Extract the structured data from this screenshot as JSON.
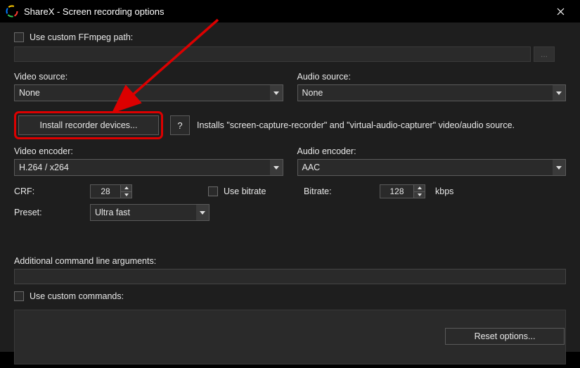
{
  "window": {
    "title": "ShareX - Screen recording options"
  },
  "ffmpeg": {
    "useCustomPathLabel": "Use custom FFmpeg path:",
    "path": "",
    "browse": "..."
  },
  "source": {
    "videoLabel": "Video source:",
    "videoValue": "None",
    "audioLabel": "Audio source:",
    "audioValue": "None"
  },
  "install": {
    "buttonLabel": "Install recorder devices...",
    "help": "?",
    "desc": "Installs \"screen-capture-recorder\" and \"virtual-audio-capturer\" video/audio source."
  },
  "encoder": {
    "videoLabel": "Video encoder:",
    "videoValue": "H.264 / x264",
    "audioLabel": "Audio encoder:",
    "audioValue": "AAC"
  },
  "params": {
    "crfLabel": "CRF:",
    "crfValue": "28",
    "useBitrateLabel": "Use bitrate",
    "presetLabel": "Preset:",
    "presetValue": "Ultra fast",
    "bitrateLabel": "Bitrate:",
    "bitrateValue": "128",
    "bitrateUnit": "kbps"
  },
  "extra": {
    "argsLabel": "Additional command line arguments:",
    "argsValue": "",
    "customCmdLabel": "Use custom commands:",
    "customCmdValue": ""
  },
  "reset": {
    "label": "Reset options..."
  }
}
